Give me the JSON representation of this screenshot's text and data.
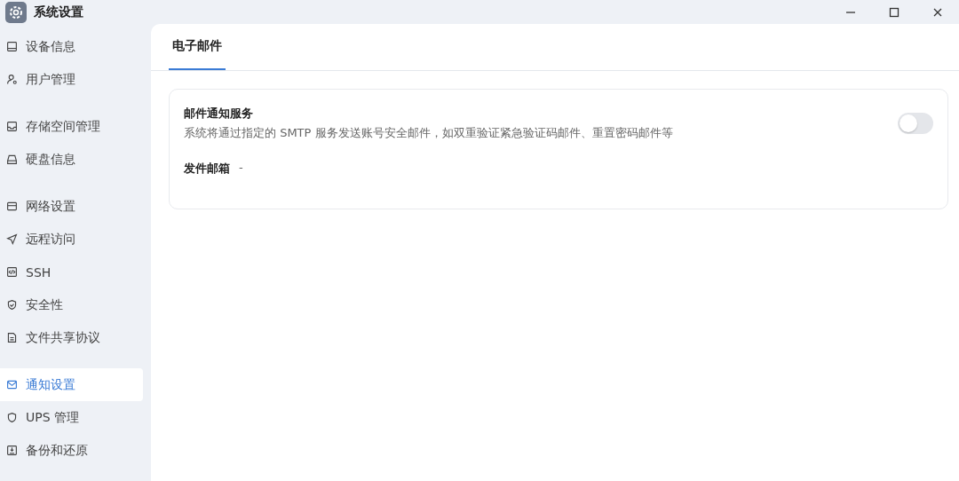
{
  "window": {
    "title": "系统设置"
  },
  "sidebar": {
    "groups": [
      [
        {
          "kind": "device",
          "label": "设备信息",
          "selected": false
        },
        {
          "kind": "user",
          "label": "用户管理",
          "selected": false
        }
      ],
      [
        {
          "kind": "storage",
          "label": "存储空间管理",
          "selected": false
        },
        {
          "kind": "disk",
          "label": "硬盘信息",
          "selected": false
        }
      ],
      [
        {
          "kind": "network",
          "label": "网络设置",
          "selected": false
        },
        {
          "kind": "remote",
          "label": "远程访问",
          "selected": false
        },
        {
          "kind": "ssh",
          "label": "SSH",
          "selected": false
        },
        {
          "kind": "security",
          "label": "安全性",
          "selected": false
        },
        {
          "kind": "file",
          "label": "文件共享协议",
          "selected": false
        }
      ],
      [
        {
          "kind": "mail",
          "label": "通知设置",
          "selected": true
        },
        {
          "kind": "ups",
          "label": "UPS 管理",
          "selected": false
        },
        {
          "kind": "backup",
          "label": "备份和还原",
          "selected": false
        }
      ]
    ]
  },
  "tabs": [
    {
      "label": "电子邮件",
      "selected": true
    }
  ],
  "card": {
    "title": "邮件通知服务",
    "description": "系统将通过指定的 SMTP 服务发送账号安全邮件，如双重验证紧急验证码邮件、重置密码邮件等",
    "toggle": {
      "on": false
    },
    "sender_label": "发件邮箱",
    "sender_value": "-"
  }
}
